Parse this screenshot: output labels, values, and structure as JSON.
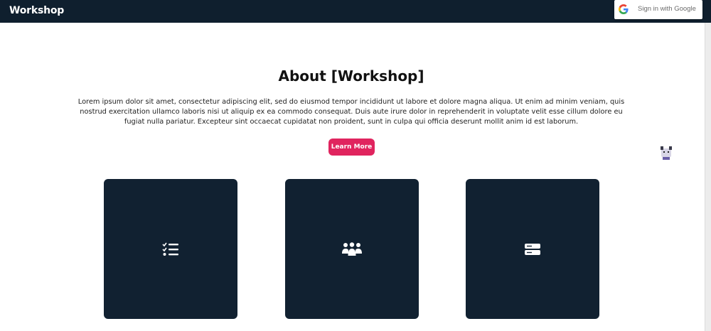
{
  "navbar": {
    "brand": "Workshop",
    "signin_label": "Sign in with Google"
  },
  "about": {
    "title": "About [Workshop]",
    "body": "Lorem ipsum dolor sit amet, consectetur adipiscing elit, sed do eiusmod tempor incididunt ut labore et dolore magna aliqua. Ut enim ad minim veniam, quis nostrud exercitation ullamco laboris nisi ut aliquip ex ea commodo consequat. Duis aute irure dolor in reprehenderit in voluptate velit esse cillum dolore eu fugiat nulla pariatur. Excepteur sint occaecat cupidatat non proident, sunt in culpa qui officia deserunt mollit anim id est laborum.",
    "button_label": "Learn More"
  },
  "cards": [
    {
      "icon": "checklist-icon"
    },
    {
      "icon": "people-group-icon"
    },
    {
      "icon": "server-icon"
    }
  ],
  "colors": {
    "navbar_bg": "#0f1f2e",
    "card_bg": "#112131",
    "accent": "#e0245e"
  }
}
